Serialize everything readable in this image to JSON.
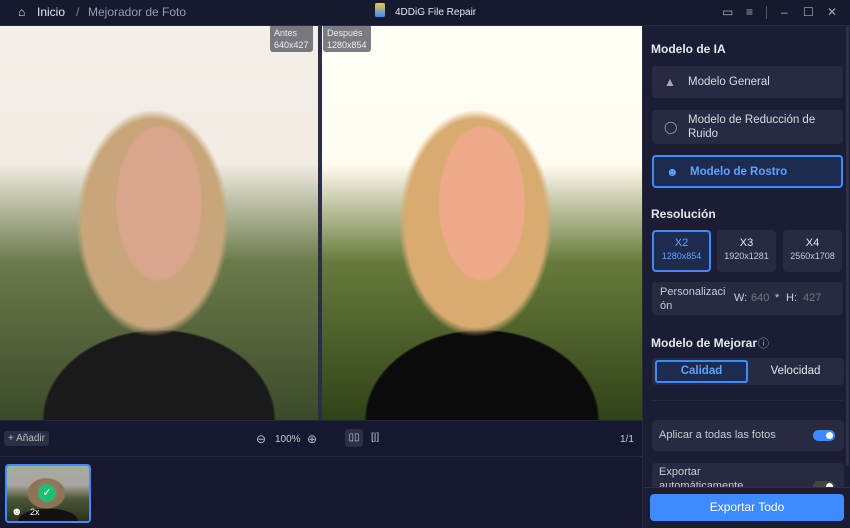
{
  "titlebar": {
    "home": "Inicio",
    "separator": "/",
    "page": "Mejorador de Foto",
    "app_title": "4DDiG File Repair"
  },
  "preview": {
    "before_label": "Antes",
    "before_size": "640x427",
    "after_label": "Después",
    "after_size": "1280x854"
  },
  "toolbar": {
    "add": "+ Añadir",
    "zoom": "100%",
    "page": "1/1"
  },
  "thumbnail": {
    "scale": "2x"
  },
  "side": {
    "ai_title": "Modelo de IA",
    "models": [
      {
        "label": "Modelo General"
      },
      {
        "label": "Modelo de Reducción de Ruido"
      },
      {
        "label": "Modelo de Rostro"
      }
    ],
    "res_title": "Resolución",
    "resolutions": [
      {
        "label": "X2",
        "size": "1280x854"
      },
      {
        "label": "X3",
        "size": "1920x1281"
      },
      {
        "label": "X4",
        "size": "2560x1708"
      }
    ],
    "custom": {
      "label": "Personalización",
      "w_label": "W:",
      "w": "640",
      "sep": "*",
      "h_label": "H:",
      "h": "427"
    },
    "enhance_title": "Modelo de Mejorar",
    "modes": [
      "Calidad",
      "Velocidad"
    ],
    "apply_all": "Aplicar a todas las fotos",
    "auto_export": "Exportar automáticamente",
    "export_all": "Exportar Todo"
  },
  "colors": {
    "accent": "#3d8bff",
    "success": "#1fbf73"
  }
}
